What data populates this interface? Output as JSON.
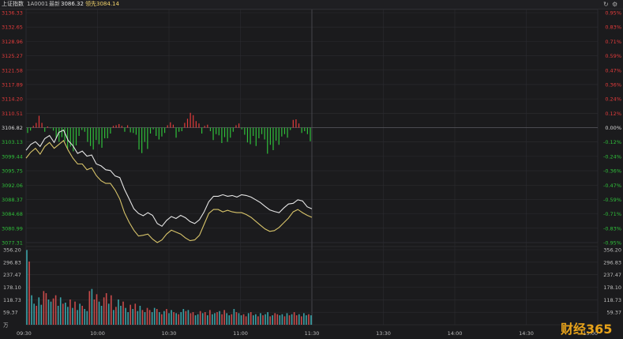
{
  "header": {
    "index_name": "上证指数",
    "code": "1A0001",
    "latest_label": "最新",
    "latest_value": "3086.32",
    "lead_label": "领先",
    "lead_value": "3084.14"
  },
  "icons": {
    "refresh": "refresh-icon",
    "settings": "gear-icon"
  },
  "colors": {
    "up": "#e23b3b",
    "down": "#2fbf3a",
    "index_line": "#e6e6e6",
    "lead_line": "#d8c46a",
    "flat": "#d8d8d8"
  },
  "watermark": {
    "part1": "财经",
    "part2": "365"
  },
  "chart_data": [
    {
      "type": "line",
      "name": "intraday-price",
      "x_labels": [
        "09:30",
        "10:00",
        "10:30",
        "11:00",
        "11:30",
        "13:30",
        "14:00",
        "14:30",
        "15:00"
      ],
      "prev_close": 3106.82,
      "ylim": [
        3077.31,
        3136.33
      ],
      "y_ticks_left": [
        "3136.33",
        "3132.65",
        "3128.96",
        "3125.27",
        "3121.58",
        "3117.89",
        "3114.20",
        "3110.51",
        "3106.82",
        "3103.13",
        "3099.44",
        "3095.75",
        "3092.06",
        "3088.37",
        "3084.68",
        "3080.99",
        "3077.31"
      ],
      "y_ticks_right": [
        "0.95%",
        "0.83%",
        "0.71%",
        "0.59%",
        "0.47%",
        "0.36%",
        "0.24%",
        "0.12%",
        "0.00%",
        "-0.12%",
        "-0.24%",
        "-0.36%",
        "-0.47%",
        "-0.59%",
        "-0.71%",
        "-0.83%",
        "-0.95%"
      ],
      "series": [
        {
          "name": "最新",
          "values": [
            3101.0,
            3102.5,
            3103.2,
            3102.0,
            3104.0,
            3104.8,
            3103.0,
            3105.6,
            3106.2,
            3103.5,
            3102.2,
            3100.2,
            3100.8,
            3099.5,
            3099.8,
            3097.5,
            3097.0,
            3096.0,
            3095.8,
            3094.4,
            3094.0,
            3091.0,
            3088.5,
            3086.0,
            3084.8,
            3084.2,
            3085.0,
            3084.3,
            3082.2,
            3081.5,
            3083.0,
            3084.0,
            3083.5,
            3084.3,
            3083.7,
            3082.7,
            3082.2,
            3083.2,
            3085.2,
            3087.8,
            3089.2,
            3089.2,
            3089.6,
            3089.2,
            3089.4,
            3089.0,
            3089.6,
            3089.4,
            3089.0,
            3088.3,
            3087.6,
            3086.6,
            3085.7,
            3085.3,
            3085.0,
            3086.2,
            3087.2,
            3087.4,
            3088.3,
            3088.0,
            3086.5,
            3086.0
          ]
        },
        {
          "name": "领先",
          "values": [
            3099.0,
            3100.5,
            3101.5,
            3100.0,
            3102.0,
            3103.0,
            3101.5,
            3102.5,
            3103.5,
            3101.0,
            3099.0,
            3097.5,
            3097.5,
            3096.0,
            3096.5,
            3094.5,
            3093.2,
            3092.5,
            3092.5,
            3090.8,
            3088.5,
            3085.0,
            3082.5,
            3080.5,
            3079.0,
            3079.2,
            3079.5,
            3078.2,
            3077.3,
            3078.0,
            3079.5,
            3080.5,
            3080.0,
            3079.5,
            3078.5,
            3077.8,
            3078.0,
            3079.2,
            3082.0,
            3084.8,
            3085.8,
            3085.8,
            3085.2,
            3085.6,
            3085.2,
            3085.0,
            3085.0,
            3084.5,
            3083.8,
            3082.8,
            3081.8,
            3080.8,
            3080.2,
            3080.4,
            3081.2,
            3082.4,
            3083.6,
            3085.2,
            3085.8,
            3085.0,
            3084.3,
            3083.8
          ]
        }
      ],
      "strength_bars": [
        -4.5,
        -2.5,
        1.5,
        4.0,
        10.0,
        4.0,
        -3.5,
        1.0,
        -0.5,
        -2.5,
        -9.0,
        -12.0,
        -8.0,
        -11.5,
        -18.0,
        -16.0,
        -20.0,
        -15.0,
        -7.0,
        -2.0,
        -3.5,
        -12.0,
        -15.5,
        -18.5,
        -10.5,
        -14.0,
        -17.0,
        -9.0,
        -9.0,
        -5.0,
        1.5,
        2.0,
        3.0,
        1.5,
        -3.5,
        2.0,
        -4.0,
        -4.5,
        -6.0,
        -18.5,
        -21.5,
        -12.0,
        -18.0,
        -5.0,
        -1.5,
        -7.0,
        -10.0,
        -7.5,
        -4.5,
        2.0,
        4.5,
        2.5,
        -8.5,
        -3.5,
        -3.0,
        4.0,
        7.5,
        12.5,
        10.5,
        5.5,
        3.5,
        -5.0,
        1.5,
        2.5,
        -3.0,
        -10.5,
        -5.5,
        -6.5,
        -13.0,
        -8.0,
        -12.0,
        -8.5,
        -3.5,
        2.0,
        3.5,
        -1.5,
        -6.0,
        -12.5,
        -14.0,
        -7.0,
        -15.5,
        -9.0,
        -5.5,
        -10.0,
        -22.0,
        -14.5,
        -19.0,
        -11.0,
        -14.5,
        -7.5,
        -5.5,
        -8.5,
        -2.0,
        6.5,
        7.0,
        3.5,
        -4.5,
        -3.0,
        -5.5,
        -11.5
      ]
    },
    {
      "type": "bar",
      "name": "volume",
      "unit": "万",
      "ylim": [
        0,
        356.2
      ],
      "y_ticks_left": [
        "356.20",
        "296.83",
        "237.47",
        "178.10",
        "118.73",
        "59.37",
        "万"
      ],
      "y_ticks_right": [
        "356.20",
        "296.83",
        "237.47",
        "178.10",
        "118.73",
        "59.37"
      ],
      "values": [
        355,
        300,
        140,
        100,
        90,
        130,
        95,
        160,
        150,
        120,
        110,
        125,
        140,
        90,
        130,
        100,
        105,
        85,
        120,
        80,
        110,
        70,
        100,
        90,
        75,
        65,
        160,
        170,
        120,
        145,
        110,
        90,
        130,
        150,
        100,
        140,
        70,
        85,
        120,
        90,
        110,
        80,
        60,
        95,
        75,
        100,
        65,
        90,
        70,
        60,
        80,
        70,
        60,
        80,
        75,
        60,
        50,
        65,
        75,
        55,
        70,
        60,
        55,
        50,
        60,
        75,
        65,
        70,
        55,
        60,
        45,
        50,
        65,
        55,
        60,
        45,
        70,
        50,
        55,
        60,
        65,
        50,
        70,
        55,
        45,
        50,
        75,
        60,
        55,
        45,
        50,
        40,
        55,
        60,
        45,
        50,
        40,
        55,
        45,
        50,
        60,
        40,
        45,
        55,
        50,
        45,
        50,
        40,
        55,
        45,
        50,
        60,
        45,
        50,
        40,
        55,
        45,
        50,
        45
      ],
      "value_direction": [
        -1,
        1,
        -1,
        -1,
        1,
        -1,
        -1,
        1,
        1,
        -1,
        -1,
        1,
        1,
        -1,
        -1,
        1,
        -1,
        -1,
        1,
        -1,
        1,
        -1,
        -1,
        1,
        -1,
        -1,
        1,
        -1,
        1,
        1,
        -1,
        -1,
        1,
        1,
        -1,
        1,
        -1,
        1,
        -1,
        -1,
        1,
        -1,
        -1,
        1,
        -1,
        1,
        -1,
        -1,
        1,
        -1,
        1,
        1,
        -1,
        -1,
        1,
        -1,
        1,
        -1,
        1,
        -1,
        -1,
        1,
        -1,
        1,
        -1,
        -1,
        1,
        -1,
        1,
        1,
        -1,
        -1,
        1,
        -1,
        1,
        -1,
        1,
        -1,
        -1,
        1,
        -1,
        1,
        1,
        -1,
        -1,
        1,
        -1,
        1,
        -1,
        -1,
        1,
        1,
        -1,
        1,
        -1,
        -1,
        1,
        -1,
        1,
        -1,
        -1,
        1,
        -1,
        1,
        1,
        -1,
        -1,
        1,
        -1,
        1,
        -1,
        1,
        1,
        -1,
        1,
        -1,
        -1,
        1,
        -1
      ]
    }
  ]
}
